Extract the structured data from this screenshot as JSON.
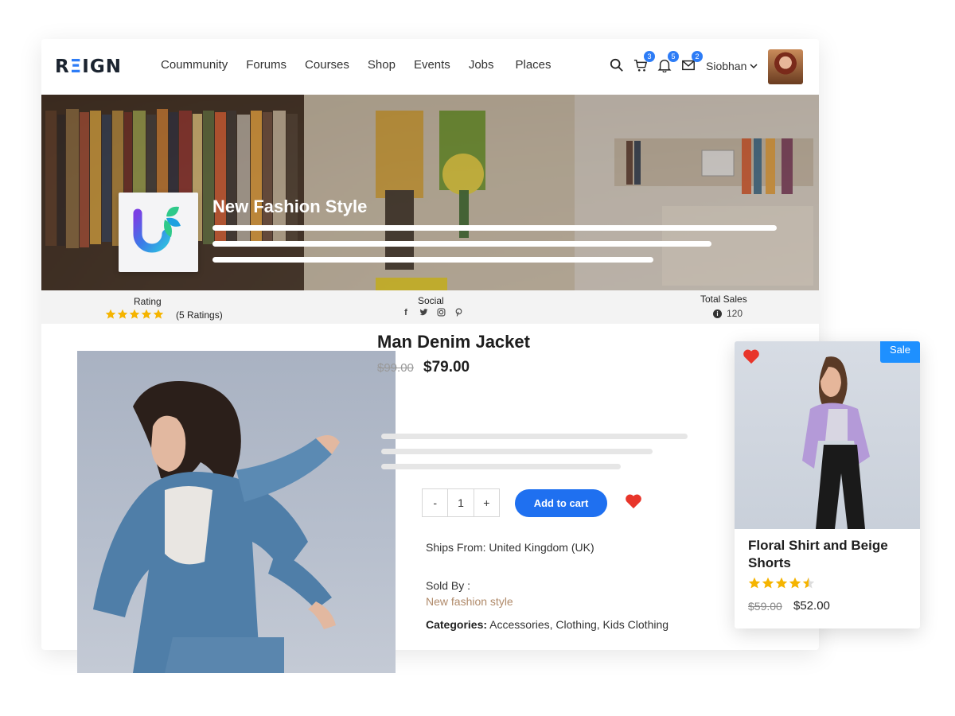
{
  "header": {
    "logo": {
      "part1": "R",
      "part2": "Ξ",
      "part3": "IGN"
    },
    "nav": [
      "Coummunity",
      "Forums",
      "Courses",
      "Shop",
      "Events",
      "Jobs",
      "Places"
    ],
    "cart_count": "3",
    "notification_count": "5",
    "message_count": "2",
    "username": "Siobhan"
  },
  "banner": {
    "store_name": "New Fashion Style"
  },
  "stats": {
    "rating_label": "Rating",
    "rating_stars": 5,
    "rating_count": "(5 Ratings)",
    "social_label": "Social",
    "social_icons": [
      "facebook-icon",
      "twitter-icon",
      "instagram-icon",
      "pinterest-icon"
    ],
    "sales_label": "Total Sales",
    "sales_value": "120"
  },
  "product": {
    "title": "Man Denim Jacket",
    "old_price": "$99.00",
    "price": "$79.00",
    "quantity": "1",
    "minus": "-",
    "plus": "+",
    "add_to_cart": "Add to cart",
    "ships_from": "Ships From: United Kingdom (UK)",
    "sold_by_label": "Sold By :",
    "seller": "New fashion style",
    "categories_label": "Categories:",
    "categories": "Accessories, Clothing, Kids Clothing"
  },
  "side_card": {
    "sale_label": "Sale",
    "title": "Floral Shirt and Beige Shorts",
    "rating": 4.5,
    "old_price": "$59.00",
    "price": "$52.00"
  },
  "colors": {
    "accent": "#1f70f0",
    "badge": "#2d7cf6",
    "star": "#f5b400",
    "heart": "#e8352a",
    "sale": "#1e90ff"
  }
}
